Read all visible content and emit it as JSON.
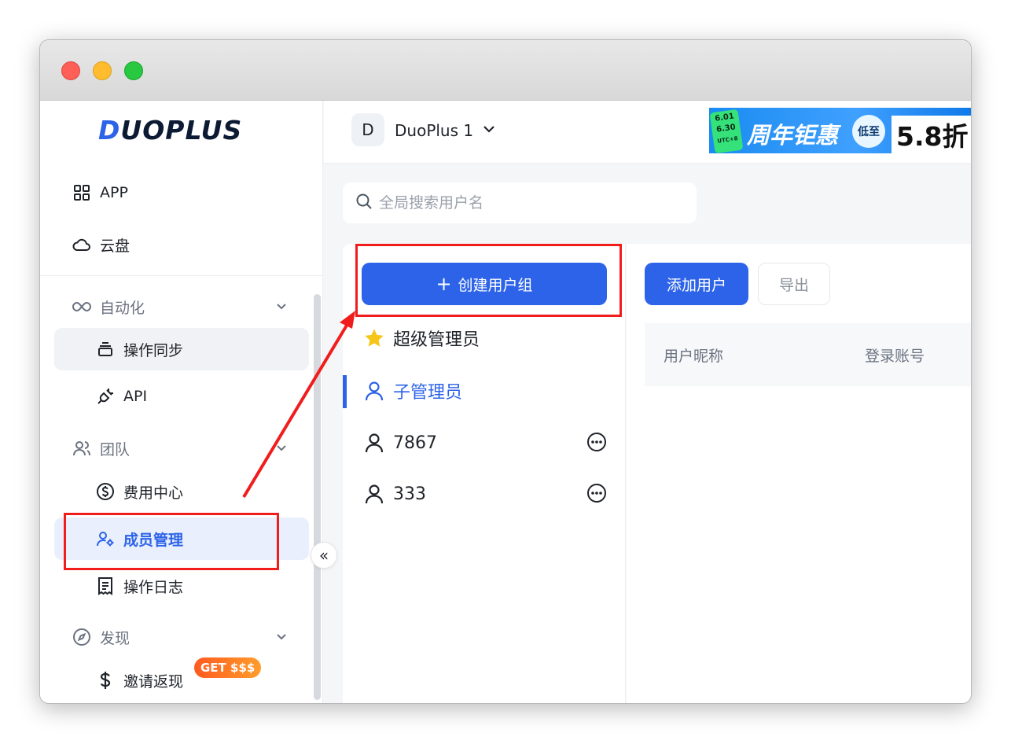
{
  "brand": {
    "logo_prefix": "D",
    "logo_rest": "UOPLUS"
  },
  "sidebar": {
    "top_items": [
      {
        "label": "APP",
        "icon": "grid-icon"
      },
      {
        "label": "云盘",
        "icon": "cloud-icon"
      }
    ],
    "groups": [
      {
        "label": "自动化",
        "icon": "infinity-icon",
        "items": [
          {
            "label": "操作同步",
            "icon": "sync-stack-icon"
          },
          {
            "label": "API",
            "icon": "plug-icon"
          }
        ]
      },
      {
        "label": "团队",
        "icon": "team-icon",
        "items": [
          {
            "label": "费用中心",
            "icon": "dollar-circle-icon"
          },
          {
            "label": "成员管理",
            "icon": "member-settings-icon"
          },
          {
            "label": "操作日志",
            "icon": "log-icon"
          }
        ]
      },
      {
        "label": "发现",
        "icon": "compass-icon",
        "items": [
          {
            "label": "邀请返现",
            "icon": "dollar-icon"
          }
        ]
      }
    ],
    "invite_badge": "GET $$$",
    "collapse_symbol": "«"
  },
  "header": {
    "workspace_avatar": "D",
    "workspace_name": "DuoPlus 1",
    "promo": {
      "date_top": "6.01",
      "date_bottom": "6.30",
      "date_tz": "UTC+8",
      "title": "周年钜惠",
      "low_label": "低至",
      "discount": "5.8折"
    }
  },
  "search": {
    "placeholder": "全局搜索用户名"
  },
  "groups_panel": {
    "create_label": "创建用户组",
    "create_plus": "+",
    "items": [
      {
        "label": "超级管理员",
        "icon": "star-icon"
      },
      {
        "label": "子管理员",
        "icon": "user-icon"
      },
      {
        "label": "7867",
        "icon": "user-icon"
      },
      {
        "label": "333",
        "icon": "user-icon"
      }
    ]
  },
  "users_panel": {
    "add_label": "添加用户",
    "export_label": "导出",
    "columns": [
      "用户昵称",
      "登录账号"
    ]
  },
  "colors": {
    "accent": "#2d63e8",
    "annotation": "#f11d1d"
  }
}
